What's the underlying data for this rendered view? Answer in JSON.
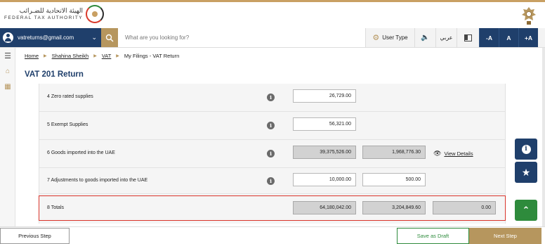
{
  "header": {
    "logo_arabic": "الهيئة الاتحادية للضـرائب",
    "logo_english": "FEDERAL TAX AUTHORITY",
    "logo_icon": "fta-logo-icon",
    "emblem_icon": "uae-emblem-icon",
    "accent_color": "#c9a063"
  },
  "nav": {
    "user_email": "vatreturns@gmail.com",
    "search_placeholder": "What are you looking for?",
    "user_type_label": "User Type",
    "language_label": "عربي",
    "font_decrease": "-A",
    "font_reset": "A",
    "font_increase": "+A",
    "primary_color": "#1f3f6b",
    "gold_color": "#b6965e"
  },
  "breadcrumb": {
    "home": "Home",
    "user": "Shahina Sheikh",
    "vat": "VAT",
    "current": "My Filings - VAT Return"
  },
  "page": {
    "title": "VAT 201 Return"
  },
  "rows": [
    {
      "label": "4 Zero rated supplies",
      "amount": "26,729.00"
    },
    {
      "label": "5 Exempt Supplies",
      "amount": "56,321.00"
    },
    {
      "label": "6 Goods imported into the UAE",
      "amount": "39,375,526.00",
      "vat": "1,968,776.30",
      "link": "View Details"
    },
    {
      "label": "7 Adjustments to goods imported into the UAE",
      "amount": "10,000.00",
      "vat": "500.00"
    },
    {
      "label": "8 Totals",
      "amount": "64,180,042.00",
      "vat": "3,204,849.60",
      "adjustment": "0.00"
    }
  ],
  "footer": {
    "previous": "Previous Step",
    "draft": "Save as Draft",
    "next": "Next Step"
  }
}
